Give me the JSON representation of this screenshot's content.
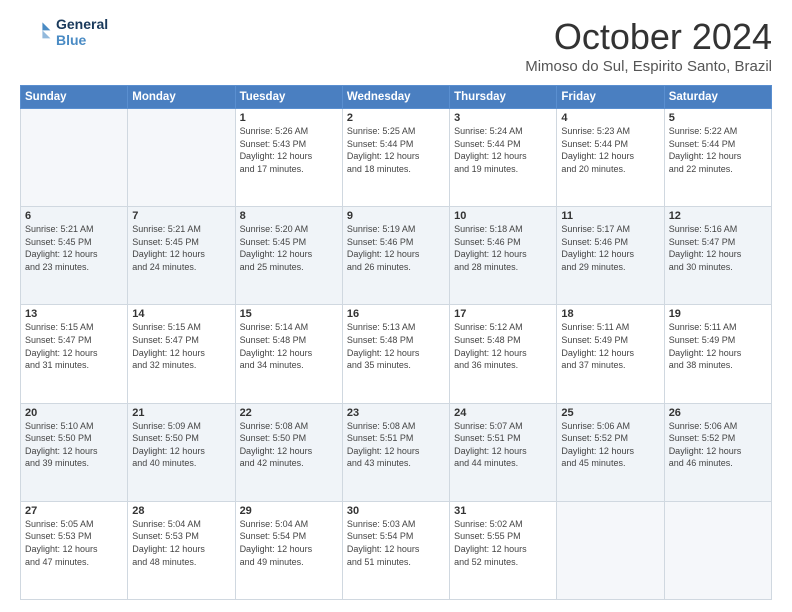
{
  "header": {
    "logo_line1": "General",
    "logo_line2": "Blue",
    "month": "October 2024",
    "location": "Mimoso do Sul, Espirito Santo, Brazil"
  },
  "days_of_week": [
    "Sunday",
    "Monday",
    "Tuesday",
    "Wednesday",
    "Thursday",
    "Friday",
    "Saturday"
  ],
  "weeks": [
    [
      {
        "day": "",
        "info": ""
      },
      {
        "day": "",
        "info": ""
      },
      {
        "day": "1",
        "info": "Sunrise: 5:26 AM\nSunset: 5:43 PM\nDaylight: 12 hours\nand 17 minutes."
      },
      {
        "day": "2",
        "info": "Sunrise: 5:25 AM\nSunset: 5:44 PM\nDaylight: 12 hours\nand 18 minutes."
      },
      {
        "day": "3",
        "info": "Sunrise: 5:24 AM\nSunset: 5:44 PM\nDaylight: 12 hours\nand 19 minutes."
      },
      {
        "day": "4",
        "info": "Sunrise: 5:23 AM\nSunset: 5:44 PM\nDaylight: 12 hours\nand 20 minutes."
      },
      {
        "day": "5",
        "info": "Sunrise: 5:22 AM\nSunset: 5:44 PM\nDaylight: 12 hours\nand 22 minutes."
      }
    ],
    [
      {
        "day": "6",
        "info": "Sunrise: 5:21 AM\nSunset: 5:45 PM\nDaylight: 12 hours\nand 23 minutes."
      },
      {
        "day": "7",
        "info": "Sunrise: 5:21 AM\nSunset: 5:45 PM\nDaylight: 12 hours\nand 24 minutes."
      },
      {
        "day": "8",
        "info": "Sunrise: 5:20 AM\nSunset: 5:45 PM\nDaylight: 12 hours\nand 25 minutes."
      },
      {
        "day": "9",
        "info": "Sunrise: 5:19 AM\nSunset: 5:46 PM\nDaylight: 12 hours\nand 26 minutes."
      },
      {
        "day": "10",
        "info": "Sunrise: 5:18 AM\nSunset: 5:46 PM\nDaylight: 12 hours\nand 28 minutes."
      },
      {
        "day": "11",
        "info": "Sunrise: 5:17 AM\nSunset: 5:46 PM\nDaylight: 12 hours\nand 29 minutes."
      },
      {
        "day": "12",
        "info": "Sunrise: 5:16 AM\nSunset: 5:47 PM\nDaylight: 12 hours\nand 30 minutes."
      }
    ],
    [
      {
        "day": "13",
        "info": "Sunrise: 5:15 AM\nSunset: 5:47 PM\nDaylight: 12 hours\nand 31 minutes."
      },
      {
        "day": "14",
        "info": "Sunrise: 5:15 AM\nSunset: 5:47 PM\nDaylight: 12 hours\nand 32 minutes."
      },
      {
        "day": "15",
        "info": "Sunrise: 5:14 AM\nSunset: 5:48 PM\nDaylight: 12 hours\nand 34 minutes."
      },
      {
        "day": "16",
        "info": "Sunrise: 5:13 AM\nSunset: 5:48 PM\nDaylight: 12 hours\nand 35 minutes."
      },
      {
        "day": "17",
        "info": "Sunrise: 5:12 AM\nSunset: 5:48 PM\nDaylight: 12 hours\nand 36 minutes."
      },
      {
        "day": "18",
        "info": "Sunrise: 5:11 AM\nSunset: 5:49 PM\nDaylight: 12 hours\nand 37 minutes."
      },
      {
        "day": "19",
        "info": "Sunrise: 5:11 AM\nSunset: 5:49 PM\nDaylight: 12 hours\nand 38 minutes."
      }
    ],
    [
      {
        "day": "20",
        "info": "Sunrise: 5:10 AM\nSunset: 5:50 PM\nDaylight: 12 hours\nand 39 minutes."
      },
      {
        "day": "21",
        "info": "Sunrise: 5:09 AM\nSunset: 5:50 PM\nDaylight: 12 hours\nand 40 minutes."
      },
      {
        "day": "22",
        "info": "Sunrise: 5:08 AM\nSunset: 5:50 PM\nDaylight: 12 hours\nand 42 minutes."
      },
      {
        "day": "23",
        "info": "Sunrise: 5:08 AM\nSunset: 5:51 PM\nDaylight: 12 hours\nand 43 minutes."
      },
      {
        "day": "24",
        "info": "Sunrise: 5:07 AM\nSunset: 5:51 PM\nDaylight: 12 hours\nand 44 minutes."
      },
      {
        "day": "25",
        "info": "Sunrise: 5:06 AM\nSunset: 5:52 PM\nDaylight: 12 hours\nand 45 minutes."
      },
      {
        "day": "26",
        "info": "Sunrise: 5:06 AM\nSunset: 5:52 PM\nDaylight: 12 hours\nand 46 minutes."
      }
    ],
    [
      {
        "day": "27",
        "info": "Sunrise: 5:05 AM\nSunset: 5:53 PM\nDaylight: 12 hours\nand 47 minutes."
      },
      {
        "day": "28",
        "info": "Sunrise: 5:04 AM\nSunset: 5:53 PM\nDaylight: 12 hours\nand 48 minutes."
      },
      {
        "day": "29",
        "info": "Sunrise: 5:04 AM\nSunset: 5:54 PM\nDaylight: 12 hours\nand 49 minutes."
      },
      {
        "day": "30",
        "info": "Sunrise: 5:03 AM\nSunset: 5:54 PM\nDaylight: 12 hours\nand 51 minutes."
      },
      {
        "day": "31",
        "info": "Sunrise: 5:02 AM\nSunset: 5:55 PM\nDaylight: 12 hours\nand 52 minutes."
      },
      {
        "day": "",
        "info": ""
      },
      {
        "day": "",
        "info": ""
      }
    ]
  ]
}
